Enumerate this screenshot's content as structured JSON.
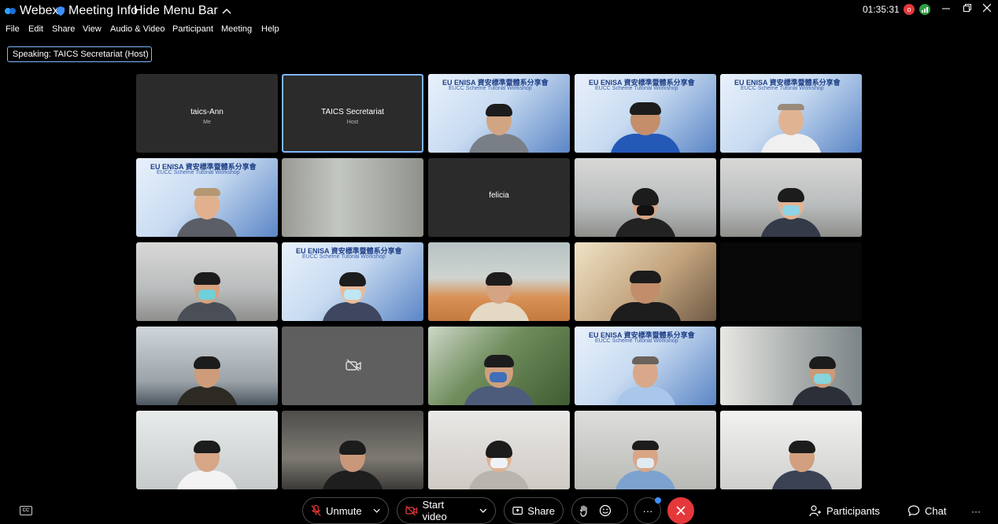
{
  "titlebar": {
    "app_name": "Webex",
    "meeting_info": "Meeting Info",
    "hide_menu_bar": "Hide Menu Bar",
    "clock": "01:35:31",
    "record_badge": "o"
  },
  "menu": [
    "File",
    "Edit",
    "Share",
    "View",
    "Audio & Video",
    "Participant",
    "Meeting",
    "Help"
  ],
  "speaking": "Speaking: TAICS Secretariat (Host)",
  "banner": {
    "line1": "EU ENISA 資安標準暨體系分享會",
    "line2": "EUCC Scheme Tutorial Workshop"
  },
  "tiles": [
    {
      "name": "taics-Ann",
      "sub": "Me"
    },
    {
      "name": "TAICS Secretariat",
      "sub": "Host"
    },
    {
      "name": "felicia",
      "sub": ""
    }
  ],
  "controls": {
    "unmute": "Unmute",
    "start_video": "Start video",
    "share": "Share",
    "more": "···",
    "participants": "Participants",
    "chat": "Chat",
    "cc": "CC",
    "overflow": "···"
  },
  "colors": {
    "accent": "#7fb7ff",
    "end_call": "#e5383b",
    "tile_dark": "#2b2b2b"
  }
}
